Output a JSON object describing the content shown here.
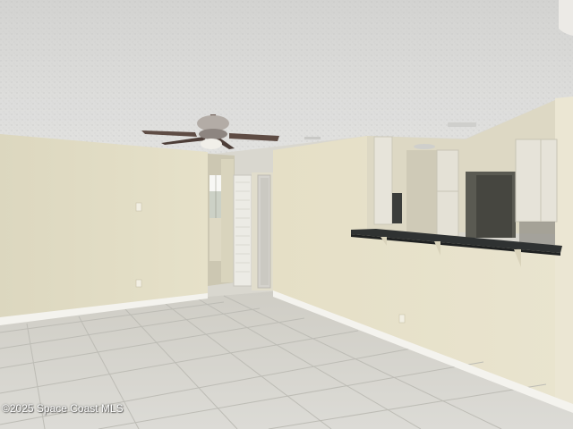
{
  "photo": {
    "watermark": "©2025 Space Coast MLS",
    "subjects": [
      "ceiling-fan",
      "kitchen-breakthrough-counter",
      "tile-floor",
      "hallway-doors",
      "window"
    ],
    "colors": {
      "ceiling": "#e6e6e4",
      "wall": "#e3ddc4",
      "floor": "#d6d5cf",
      "baseboard": "#f4f3ee",
      "countertop": "#2f3232",
      "cabinet": "#e4e1d6",
      "fan": "#6b5a52"
    }
  }
}
